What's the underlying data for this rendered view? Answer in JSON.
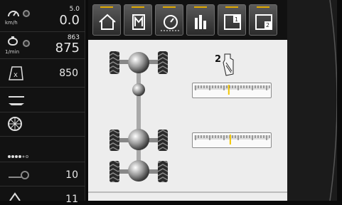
{
  "sidebar": {
    "speed": {
      "setpoint": "5.0",
      "value": "0.0",
      "unit": "km/h"
    },
    "rpm": {
      "setpoint": "863",
      "value": "875",
      "unit": "1/min"
    },
    "row3_value": "850",
    "row7_value": "10",
    "row8_value": "11"
  },
  "tabs": [
    {
      "icon": "home-icon"
    },
    {
      "icon": "memory-card-icon"
    },
    {
      "icon": "gauge-icon"
    },
    {
      "icon": "bar-chart-icon"
    },
    {
      "icon": "window-1-icon"
    },
    {
      "icon": "window-2-icon"
    }
  ],
  "main": {
    "selection_label": "2"
  },
  "sliders": [
    {
      "name": "front-axle",
      "level": 0.45
    },
    {
      "name": "rear-axle",
      "level": 0.47
    }
  ],
  "colors": {
    "accent": "#e0a800",
    "indicator": "#f2c500",
    "background": "#ededed"
  }
}
